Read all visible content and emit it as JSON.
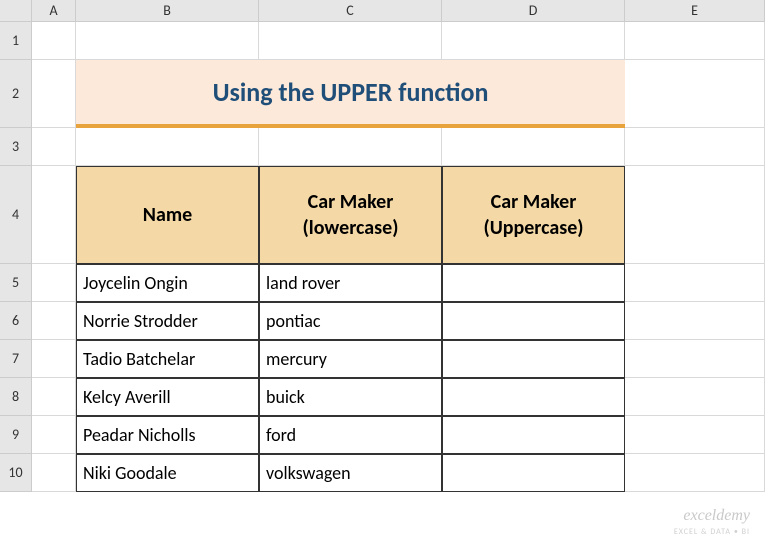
{
  "columns": [
    "A",
    "B",
    "C",
    "D",
    "E"
  ],
  "rows": [
    "1",
    "2",
    "3",
    "4",
    "5",
    "6",
    "7",
    "8",
    "9",
    "10"
  ],
  "title": "Using the UPPER function",
  "headers": {
    "name": "Name",
    "lower": "Car Maker (lowercase)",
    "upper": "Car Maker (Uppercase)"
  },
  "data": [
    {
      "name": "Joycelin Ongin",
      "lower": "land rover",
      "upper": ""
    },
    {
      "name": "Norrie Strodder",
      "lower": "pontiac",
      "upper": ""
    },
    {
      "name": "Tadio Batchelar",
      "lower": "mercury",
      "upper": ""
    },
    {
      "name": "Kelcy Averill",
      "lower": "buick",
      "upper": ""
    },
    {
      "name": "Peadar Nicholls",
      "lower": "ford",
      "upper": ""
    },
    {
      "name": "Niki Goodale",
      "lower": "volkswagen",
      "upper": ""
    }
  ],
  "watermark": "exceldemy",
  "watermark_sub": "EXCEL & DATA • BI"
}
